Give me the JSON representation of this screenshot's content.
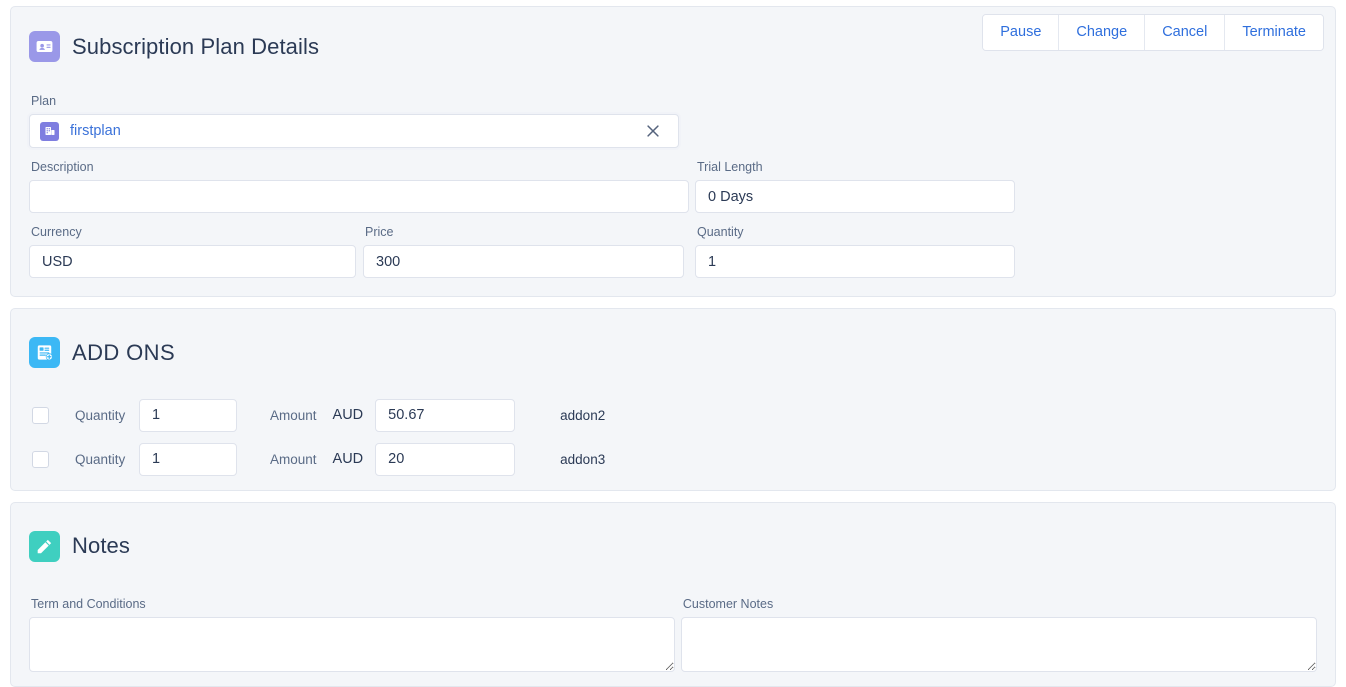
{
  "plan_card": {
    "title": "Subscription Plan Details",
    "icon": "id-card-icon",
    "actions": [
      {
        "label": "Pause",
        "name": "pause-button"
      },
      {
        "label": "Change",
        "name": "change-button"
      },
      {
        "label": "Cancel",
        "name": "cancel-button"
      },
      {
        "label": "Terminate",
        "name": "terminate-button"
      }
    ],
    "plan": {
      "label": "Plan",
      "value": "firstplan",
      "record_icon": "account-record-icon",
      "clear_icon": "close-icon"
    },
    "description": {
      "label": "Description",
      "value": "",
      "placeholder": ""
    },
    "trial_length": {
      "label": "Trial Length",
      "value": "0 Days"
    },
    "currency": {
      "label": "Currency",
      "value": "USD"
    },
    "price": {
      "label": "Price",
      "value": "300"
    },
    "quantity": {
      "label": "Quantity",
      "value": "1"
    }
  },
  "addons_card": {
    "title": "ADD ONS",
    "icon": "document-add-icon",
    "quantity_label": "Quantity",
    "amount_label": "Amount",
    "rows": [
      {
        "checked": false,
        "quantity": "1",
        "currency": "AUD",
        "amount": "50.67",
        "name": "addon2"
      },
      {
        "checked": false,
        "quantity": "1",
        "currency": "AUD",
        "amount": "20",
        "name": "addon3"
      }
    ]
  },
  "notes_card": {
    "title": "Notes",
    "icon": "pencil-icon",
    "terms": {
      "label": "Term and Conditions",
      "value": ""
    },
    "customer_notes": {
      "label": "Customer Notes",
      "value": ""
    }
  },
  "colors": {
    "accent_purple": "#9a98e8",
    "accent_blue": "#3cb8f5",
    "accent_teal": "#3fcfc0",
    "link_blue": "#2f6fdd",
    "card_bg": "#f4f6f9",
    "text_dark": "#2b3a55"
  }
}
